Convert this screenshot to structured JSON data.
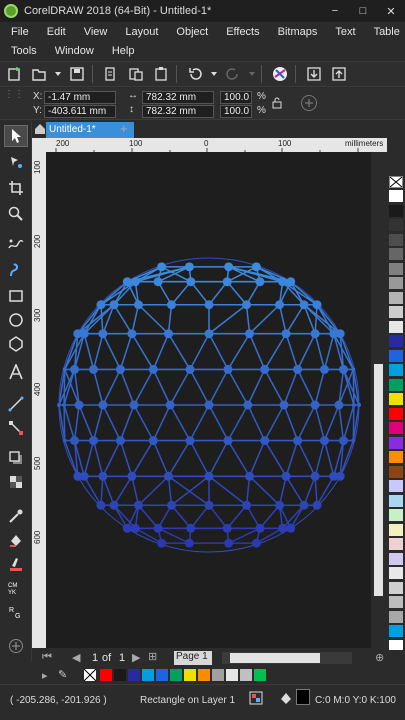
{
  "window": {
    "title": "CorelDRAW 2018 (64-Bit) - Untitled-1*",
    "minimize": "−",
    "maximize": "□",
    "close": "✕"
  },
  "menu": {
    "row1": [
      "File",
      "Edit",
      "View",
      "Layout",
      "Object",
      "Effects",
      "Bitmaps",
      "Text",
      "Table"
    ],
    "row2": [
      "Tools",
      "Window",
      "Help"
    ]
  },
  "toolbar": {
    "icons": [
      "new-document-icon",
      "open-icon",
      "save-icon",
      "print-icon",
      "cut-icon",
      "copy-icon",
      "paste-icon",
      "undo-icon",
      "redo-icon",
      "corel-connect-icon",
      "import-icon",
      "export-icon"
    ]
  },
  "properties": {
    "x_label": "X:",
    "x_value": "-1.47 mm",
    "y_label": "Y:",
    "y_value": "-403.611 mm",
    "width_value": "782.32 mm",
    "height_value": "782.32 mm",
    "scale_w": "100.0",
    "scale_h": "100.0",
    "percent": "%"
  },
  "document": {
    "tab_label": "Untitled-1*",
    "add_tab": "+"
  },
  "ruler": {
    "h_labels": [
      "200",
      "100",
      "0",
      "100"
    ],
    "unit": "millimeters",
    "v_labels": [
      "100",
      "200",
      "300",
      "400",
      "500",
      "600"
    ]
  },
  "page_nav": {
    "current": "1",
    "of": "of",
    "total": "1",
    "page_tab": "Page 1"
  },
  "status": {
    "coordinates": "( -205.286, -201.926 )",
    "selection": "Rectangle on Layer 1",
    "color_info": "C:0 M:0 Y:0 K:100"
  },
  "colors": {
    "accent": "#3a8fd8",
    "sphere_top": "#3d8fe0",
    "sphere_bottom": "#2a34b0",
    "canvas_bg": "#1e1e1e"
  },
  "palette_colors": [
    "#ffffff",
    "#1a1a1a",
    "#333333",
    "#4d4d4d",
    "#666666",
    "#808080",
    "#999999",
    "#b3b3b3",
    "#cccccc",
    "#e6e6e6",
    "#2a2aa0",
    "#1e64e0",
    "#00a0e0",
    "#00a060",
    "#f0e000",
    "#ff0000",
    "#e0007a",
    "#8a2be2",
    "#ff8c00",
    "#8b4513",
    "#c8c8ff",
    "#a8d8f0",
    "#c8f0c8",
    "#f0f0c0",
    "#f0d0d0",
    "#d0c8f0",
    "#e8e8e8",
    "#d0d0d0",
    "#bdbdbd",
    "#a8a8a8",
    "#00a0e0",
    "#ffffff"
  ],
  "strip_colors": [
    "#ff0000",
    "#1a1a1a",
    "#2a2aa0",
    "#00a0e0",
    "#1e64e0",
    "#00a060",
    "#f0e000",
    "#ff8c00",
    "#a0a0a0",
    "#e6e6e6",
    "#c0c0c0",
    "#00c050"
  ]
}
